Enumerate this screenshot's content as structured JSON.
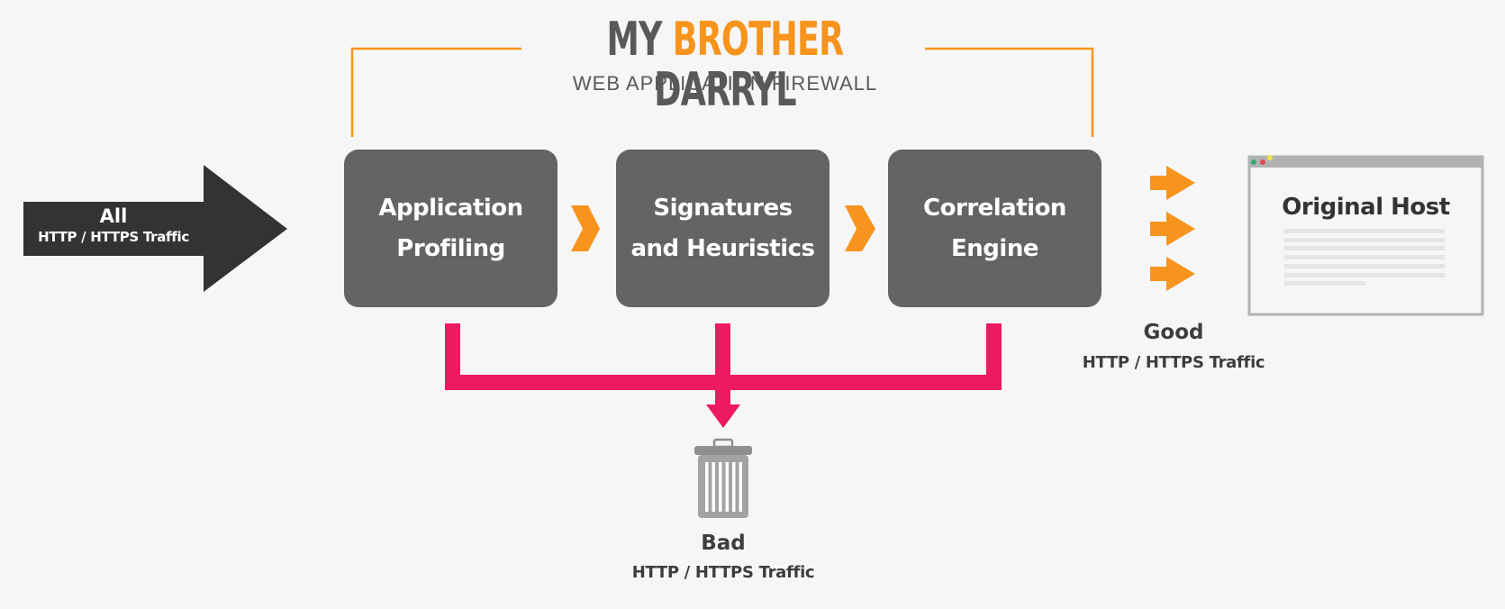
{
  "header": {
    "brand_part1": "MY",
    "brand_part2": "BROTHER",
    "brand_part3": "DARRYL",
    "subtitle": "WEB APPLICATION FIREWALL"
  },
  "input": {
    "label": "All",
    "sublabel": "HTTP / HTTPS Traffic"
  },
  "stages": [
    {
      "line1": "Application",
      "line2": "Profiling"
    },
    {
      "line1": "Signatures",
      "line2": "and Heuristics"
    },
    {
      "line1": "Correlation",
      "line2": "Engine"
    }
  ],
  "good_output": {
    "label": "Good",
    "sublabel": "HTTP / HTTPS Traffic"
  },
  "bad_output": {
    "label": "Bad",
    "sublabel": "HTTP / HTTPS Traffic"
  },
  "host": {
    "title": "Original Host"
  },
  "icons": {
    "input_arrow": "arrow-right-icon",
    "stage_chevron": "chevron-right-icon",
    "good_arrows": "arrow-right-icon",
    "browser": "browser-window-icon",
    "trash": "trash-icon"
  },
  "colors": {
    "background": "#f6f6f6",
    "brand_gray": "#58595b",
    "brand_orange": "#f7941d",
    "stage_box": "#636466",
    "input_arrow": "#333333",
    "reject_path": "#ec1a5f",
    "trash": "#a3a3a4",
    "browser_frame": "#b1b2b4"
  }
}
